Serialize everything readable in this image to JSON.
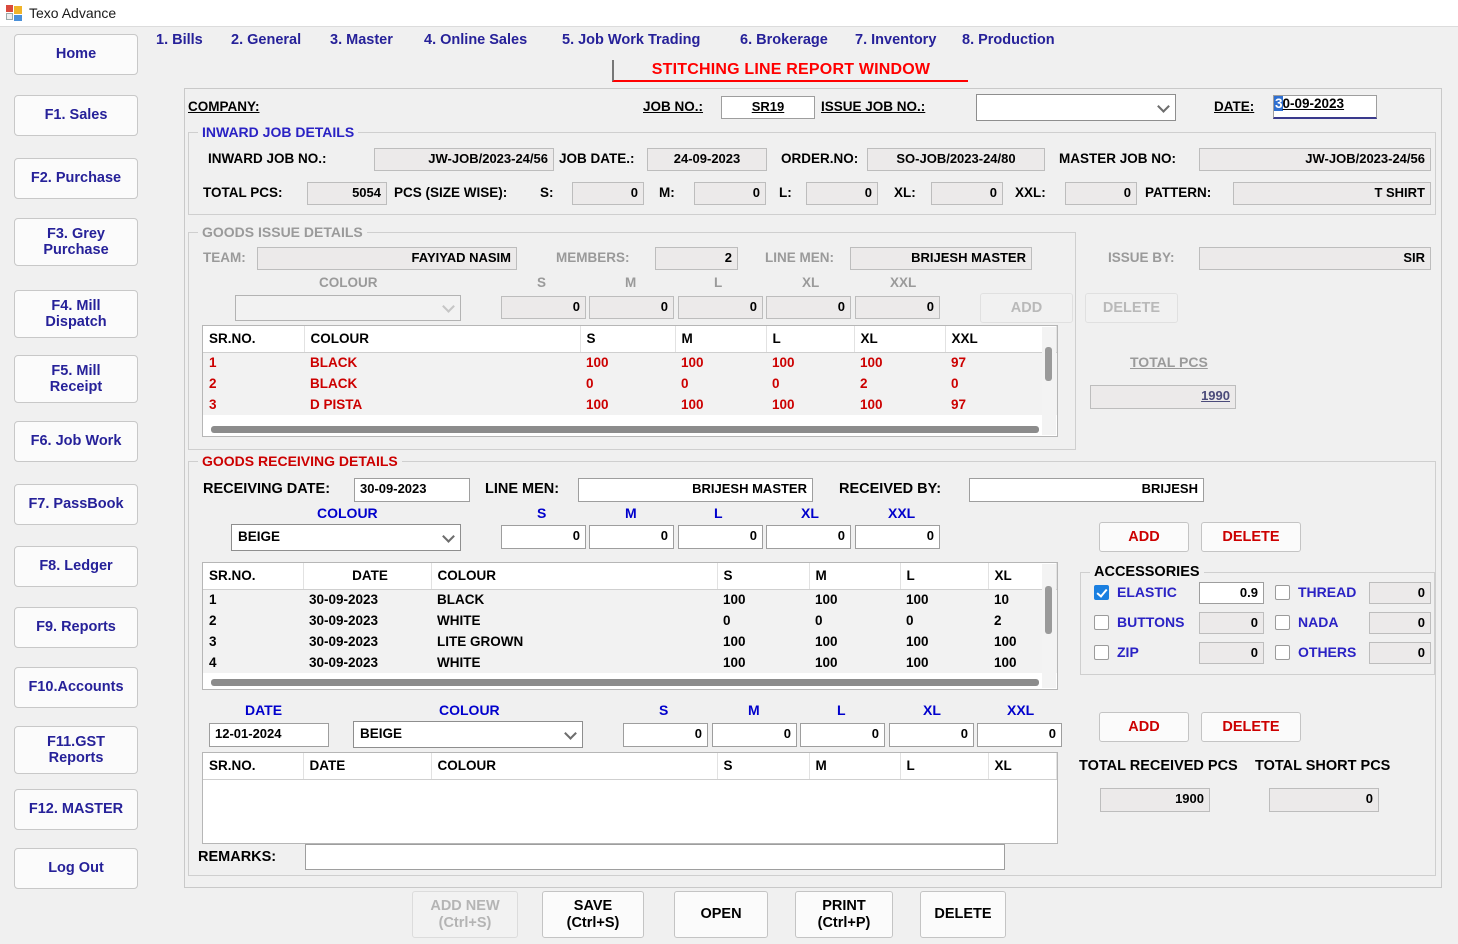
{
  "window": {
    "title": "Texo Advance",
    "icon": "app-icon"
  },
  "sidebar": {
    "items": [
      {
        "label": "Home"
      },
      {
        "label": "F1. Sales"
      },
      {
        "label": "F2. Purchase"
      },
      {
        "label": "F3. Grey\nPurchase"
      },
      {
        "label": "F4. Mill\nDispatch"
      },
      {
        "label": "F5. Mill\nReceipt"
      },
      {
        "label": "F6. Job Work"
      },
      {
        "label": "F7. PassBook"
      },
      {
        "label": "F8. Ledger"
      },
      {
        "label": "F9. Reports"
      },
      {
        "label": "F10.Accounts"
      },
      {
        "label": "F11.GST\nReports"
      },
      {
        "label": "F12. MASTER"
      },
      {
        "label": "Log Out"
      }
    ]
  },
  "menu": {
    "items": [
      {
        "label": "1. Bills"
      },
      {
        "label": "2. General"
      },
      {
        "label": "3. Master"
      },
      {
        "label": "4. Online Sales"
      },
      {
        "label": "5. Job Work Trading"
      },
      {
        "label": "6. Brokerage"
      },
      {
        "label": "7. Inventory"
      },
      {
        "label": "8. Production"
      }
    ]
  },
  "header": {
    "window_title": "STITCHING LINE REPORT WINDOW",
    "company_label": "COMPANY:",
    "job_no_label": "JOB NO.:",
    "job_no_value": "SR19",
    "issue_job_no_label": "ISSUE JOB NO.:",
    "issue_job_no_value": "",
    "date_label": "DATE:",
    "date_value": "30-09-2023",
    "date_selected_char": "3",
    "date_rest": "0-09-2023"
  },
  "inward": {
    "title": "INWARD JOB DETAILS",
    "inward_job_no_label": "INWARD JOB NO.:",
    "inward_job_no_value": "JW-JOB/2023-24/56",
    "job_date_label": "JOB DATE.:",
    "job_date_value": "24-09-2023",
    "order_no_label": "ORDER.NO:",
    "order_no_value": "SO-JOB/2023-24/80",
    "master_job_no_label": "MASTER JOB NO:",
    "master_job_no_value": "JW-JOB/2023-24/56",
    "total_pcs_label": "TOTAL PCS:",
    "total_pcs_value": "5054",
    "pcs_sizewise_label": "PCS (SIZE WISE):",
    "s_label": "S:",
    "s_value": "0",
    "m_label": "M:",
    "m_value": "0",
    "l_label": "L:",
    "l_value": "0",
    "xl_label": "XL:",
    "xl_value": "0",
    "xxl_label": "XXL:",
    "xxl_value": "0",
    "pattern_label": "PATTERN:",
    "pattern_value": "T SHIRT"
  },
  "issue": {
    "title": "GOODS ISSUE DETAILS",
    "team_label": "TEAM:",
    "team_value": "FAYIYAD NASIM",
    "members_label": "MEMBERS:",
    "members_value": "2",
    "line_men_label": "LINE MEN:",
    "line_men_value": "BRIJESH MASTER",
    "issue_by_label": "ISSUE BY:",
    "issue_by_value": "SIR",
    "colour_label": "COLOUR",
    "colour_value": "",
    "size_labels": [
      "S",
      "M",
      "L",
      "XL",
      "XXL"
    ],
    "size_values": [
      "0",
      "0",
      "0",
      "0",
      "0"
    ],
    "add_label": "ADD",
    "delete_label": "DELETE",
    "total_pcs_label": "TOTAL PCS",
    "total_pcs_value": "1990",
    "grid": {
      "columns": [
        "SR.NO.",
        "COLOUR",
        "S",
        "M",
        "L",
        "XL",
        "XXL"
      ],
      "rows": [
        [
          "1",
          "BLACK",
          "100",
          "100",
          "100",
          "100",
          "97"
        ],
        [
          "2",
          "BLACK",
          "0",
          "0",
          "0",
          "2",
          "0"
        ],
        [
          "3",
          "D PISTA",
          "100",
          "100",
          "100",
          "100",
          "97"
        ]
      ]
    }
  },
  "receiving": {
    "title": "GOODS RECEIVING DETAILS",
    "receiving_date_label": "RECEIVING DATE:",
    "receiving_date_value": "30-09-2023",
    "line_men_label": "LINE MEN:",
    "line_men_value": "BRIJESH MASTER",
    "received_by_label": "RECEIVED BY:",
    "received_by_value": "BRIJESH",
    "colour_label": "COLOUR",
    "colour_value": "BEIGE",
    "size_labels": [
      "S",
      "M",
      "L",
      "XL",
      "XXL"
    ],
    "size_values": [
      "0",
      "0",
      "0",
      "0",
      "0"
    ],
    "add_label": "ADD",
    "delete_label": "DELETE",
    "grid": {
      "columns": [
        "SR.NO.",
        "DATE",
        "COLOUR",
        "S",
        "M",
        "L",
        "XL"
      ],
      "rows": [
        [
          "1",
          "30-09-2023",
          "BLACK",
          "100",
          "100",
          "100",
          "10"
        ],
        [
          "2",
          "30-09-2023",
          "WHITE",
          "0",
          "0",
          "0",
          "2"
        ],
        [
          "3",
          "30-09-2023",
          "LITE GROWN",
          "100",
          "100",
          "100",
          "100"
        ],
        [
          "4",
          "30-09-2023",
          "WHITE",
          "100",
          "100",
          "100",
          "100"
        ]
      ]
    }
  },
  "accessories": {
    "title": "ACCESSORIES",
    "items": [
      {
        "label": "ELASTIC",
        "checked": true,
        "value": "0.9"
      },
      {
        "label": "THREAD",
        "checked": false,
        "value": "0"
      },
      {
        "label": "BUTTONS",
        "checked": false,
        "value": "0"
      },
      {
        "label": "NADA",
        "checked": false,
        "value": "0"
      },
      {
        "label": "ZIP",
        "checked": false,
        "value": "0"
      },
      {
        "label": "OTHERS",
        "checked": false,
        "value": "0"
      }
    ]
  },
  "short": {
    "date_label": "DATE",
    "date_value": "12-01-2024",
    "colour_label": "COLOUR",
    "colour_value": "BEIGE",
    "size_labels": [
      "S",
      "M",
      "L",
      "XL",
      "XXL"
    ],
    "size_values": [
      "0",
      "0",
      "0",
      "0",
      "0"
    ],
    "add_label": "ADD",
    "delete_label": "DELETE",
    "total_received_pcs_label": "TOTAL RECEIVED PCS",
    "total_received_pcs_value": "1900",
    "total_short_pcs_label": "TOTAL SHORT PCS",
    "total_short_pcs_value": "0",
    "grid": {
      "columns": [
        "SR.NO.",
        "DATE",
        "COLOUR",
        "S",
        "M",
        "L",
        "XL"
      ],
      "rows": []
    }
  },
  "footer": {
    "remarks_label": "REMARKS:",
    "remarks_value": "",
    "buttons": [
      {
        "label": "ADD NEW\n(Ctrl+S)",
        "disabled": true
      },
      {
        "label": "SAVE\n(Ctrl+S)",
        "disabled": false
      },
      {
        "label": "OPEN",
        "disabled": false
      },
      {
        "label": "PRINT\n(Ctrl+P)",
        "disabled": false
      },
      {
        "label": "DELETE",
        "disabled": false
      }
    ]
  },
  "colors": {
    "menu_blue": "#262199",
    "title_red": "#ff0000",
    "grid_red": "#cc0000",
    "label_blue": "#0000cc",
    "accent_check": "#1a7fe0"
  }
}
